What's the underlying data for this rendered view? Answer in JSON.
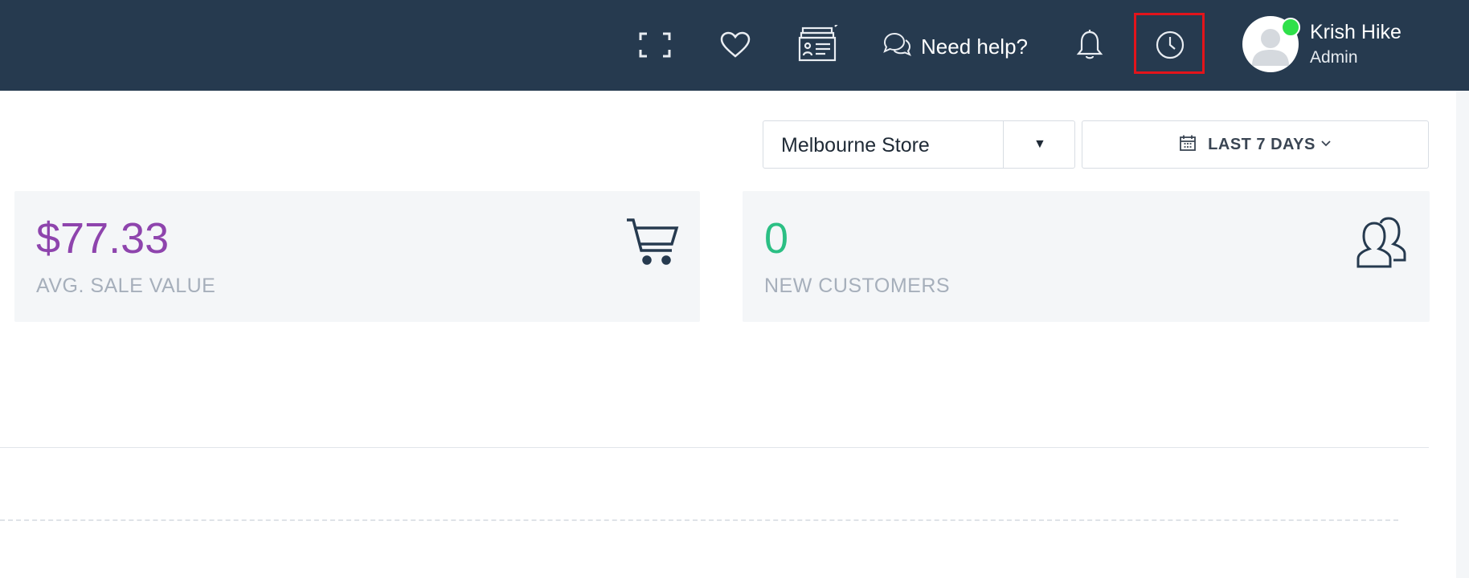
{
  "header": {
    "help_label": "Need help?",
    "user": {
      "name": "Krish Hike",
      "role": "Admin"
    },
    "icons": [
      "fullscreen-icon",
      "heart-icon",
      "register-icon",
      "chat-icon",
      "bell-icon",
      "clock-icon",
      "avatar"
    ]
  },
  "filters": {
    "store": {
      "selected": "Melbourne Store"
    },
    "date_range": {
      "label": "LAST 7 DAYS"
    }
  },
  "cards": [
    {
      "value": "$77.33",
      "caption": "AVG. SALE VALUE",
      "icon": "cart-icon",
      "color": "#8e44ad"
    },
    {
      "value": "0",
      "caption": "NEW CUSTOMERS",
      "icon": "users-icon",
      "color": "#2bbf84"
    }
  ],
  "colors": {
    "topbar": "#263a4f",
    "highlight": "#e3141b",
    "online": "#2fe04a"
  }
}
